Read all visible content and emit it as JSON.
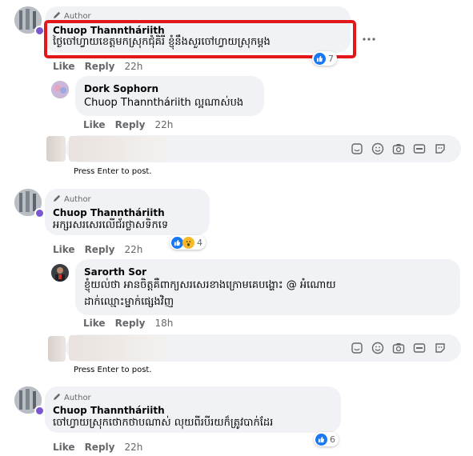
{
  "author_tag": "Author",
  "comment1": {
    "name": "Chuop Thanntháriith",
    "text": "ថ្ងៃចៅហ្វាយខេត្តមកស្រុកជុំគិរី ខ្ញុំនឹងសួរចៅហ្វាយស្រុកម្តង",
    "actions": {
      "like": "Like",
      "reply": "Reply",
      "time": "22h"
    },
    "reaction_count": "7"
  },
  "reply1": {
    "name": "Dork Sophorn",
    "mention": "Chuop Thanntháriith",
    "text": "ល្អណាស់បង",
    "actions": {
      "like": "Like",
      "reply": "Reply",
      "time": "22h"
    }
  },
  "composer1": {
    "hint": "Press Enter to post."
  },
  "comment2": {
    "name": "Chuop Thanntháriith",
    "text": "អក្សរសរសេរលើជ័រថ្លាសទិកទេ",
    "actions": {
      "like": "Like",
      "reply": "Reply",
      "time": "22h"
    },
    "reaction_count": "4"
  },
  "reply2": {
    "name": "Sarorth Sor",
    "text_line1": "ខ្ញុំយល់ថា អានចិត្តគឺពាក្យសរសេរខាងក្រោមគេបង្ហោះ @ អំណោយ",
    "text_line2": "ដាក់ឈ្មោះម្នាក់ផ្សេងវិញ",
    "actions": {
      "like": "Like",
      "reply": "Reply",
      "time": "18h"
    }
  },
  "composer2": {
    "hint": "Press Enter to post."
  },
  "comment3": {
    "name": "Chuop Thanntháriith",
    "text": "ចៅហ្វាយស្រុកថោកថាបណាស់ លុយពីរបីរយក៏ត្រូវបាក់ដែរ",
    "actions": {
      "like": "Like",
      "reply": "Reply",
      "time": "22h"
    },
    "reaction_count": "6"
  },
  "icons": [
    "pencil-icon",
    "more-icon",
    "like-reaction-icon",
    "wow-reaction-icon",
    "sticker-icon",
    "emoji-icon",
    "camera-icon",
    "gif-icon",
    "avatar-sticker-icon"
  ]
}
